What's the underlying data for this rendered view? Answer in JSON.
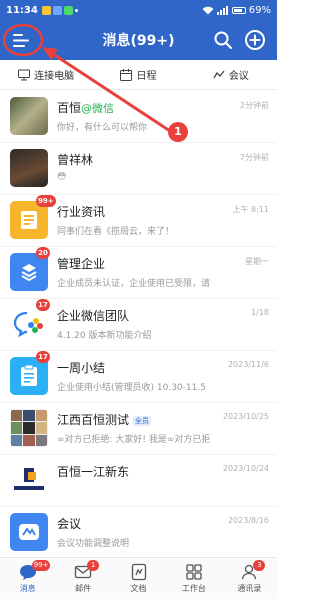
{
  "status_bar": {
    "time": "11:34",
    "battery": "69%"
  },
  "header": {
    "title": "消息(99+)"
  },
  "quickbar": {
    "items": [
      {
        "label": "连接电脑",
        "icon": "monitor-icon"
      },
      {
        "label": "日程",
        "icon": "calendar-icon"
      },
      {
        "label": "会议",
        "icon": "meeting-icon"
      }
    ]
  },
  "conversations": [
    {
      "title": "百恒",
      "tag": "@微信",
      "subtitle": "你好，有什么可以帮你",
      "time": "2分钟前",
      "badge": ""
    },
    {
      "title": "曾祥林",
      "tag": "",
      "subtitle": "😳",
      "time": "7分钟前",
      "badge": ""
    },
    {
      "title": "行业资讯",
      "tag": "",
      "subtitle": "同事们在看《揽局云，来了！",
      "time": "上午 8:11",
      "badge": "99+"
    },
    {
      "title": "管理企业",
      "tag": "",
      "subtitle": "企业成员未认证，企业使用已受限，请",
      "time": "星期一",
      "badge": "20"
    },
    {
      "title": "企业微信团队",
      "tag": "",
      "subtitle": "4.1.20 版本新功能介绍",
      "time": "1/18",
      "badge": "17"
    },
    {
      "title": "一周小结",
      "tag": "",
      "subtitle": "企业使用小结(管理员收) 10.30-11.5",
      "time": "2023/11/6",
      "badge": "17"
    },
    {
      "title": "江西百恒测试",
      "tag": "全员",
      "subtitle": "∞对方已拒绝: 大家好! 我是∞对方已拒",
      "time": "2023/10/25",
      "badge": ""
    },
    {
      "title": "百恒一江新东",
      "tag": "",
      "subtitle": "",
      "time": "2023/10/24",
      "badge": ""
    },
    {
      "title": "会议",
      "tag": "",
      "subtitle": "会议功能调整说明",
      "time": "2023/8/16",
      "badge": ""
    }
  ],
  "tabbar": {
    "tabs": [
      {
        "label": "消息",
        "badge": "99+",
        "icon": "message-icon"
      },
      {
        "label": "邮件",
        "badge": "1",
        "icon": "mail-icon"
      },
      {
        "label": "文档",
        "badge": "",
        "icon": "document-icon"
      },
      {
        "label": "工作台",
        "badge": "",
        "icon": "workbench-icon"
      },
      {
        "label": "通讯录",
        "badge": "3",
        "icon": "contacts-icon"
      }
    ]
  },
  "annotation": {
    "number": "1"
  },
  "colors": {
    "brand_blue": "#2f66c8",
    "badge_red": "#e8413d",
    "wechat_green": "#24b24f"
  }
}
